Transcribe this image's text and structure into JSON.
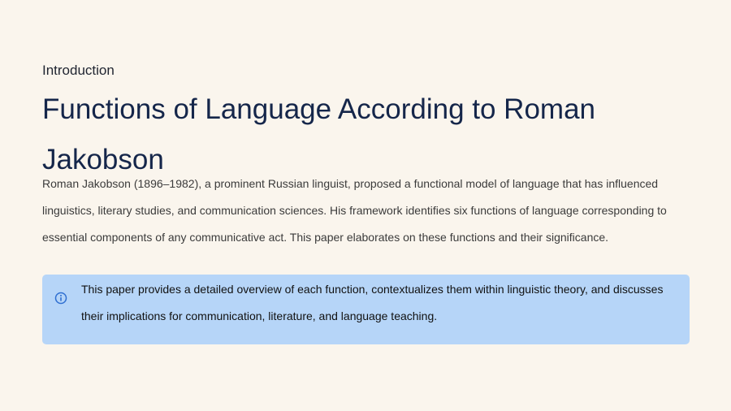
{
  "section": {
    "label": "Introduction"
  },
  "document": {
    "title": "Functions of Language According to Roman Jakobson",
    "intro": "Roman Jakobson (1896–1982), a prominent Russian linguist, proposed a functional model of language that has influenced linguistics, literary studies, and communication sciences. His framework identifies six functions of language corresponding to essential components of any communicative act. This paper elaborates on these functions and their significance."
  },
  "callout": {
    "icon": "info-icon",
    "text": "This paper provides a detailed overview of each function, contextualizes them within linguistic theory, and discusses their implications for communication, literature, and language teaching.",
    "background_color": "#b6d5f8",
    "icon_color": "#2f6fd1"
  }
}
